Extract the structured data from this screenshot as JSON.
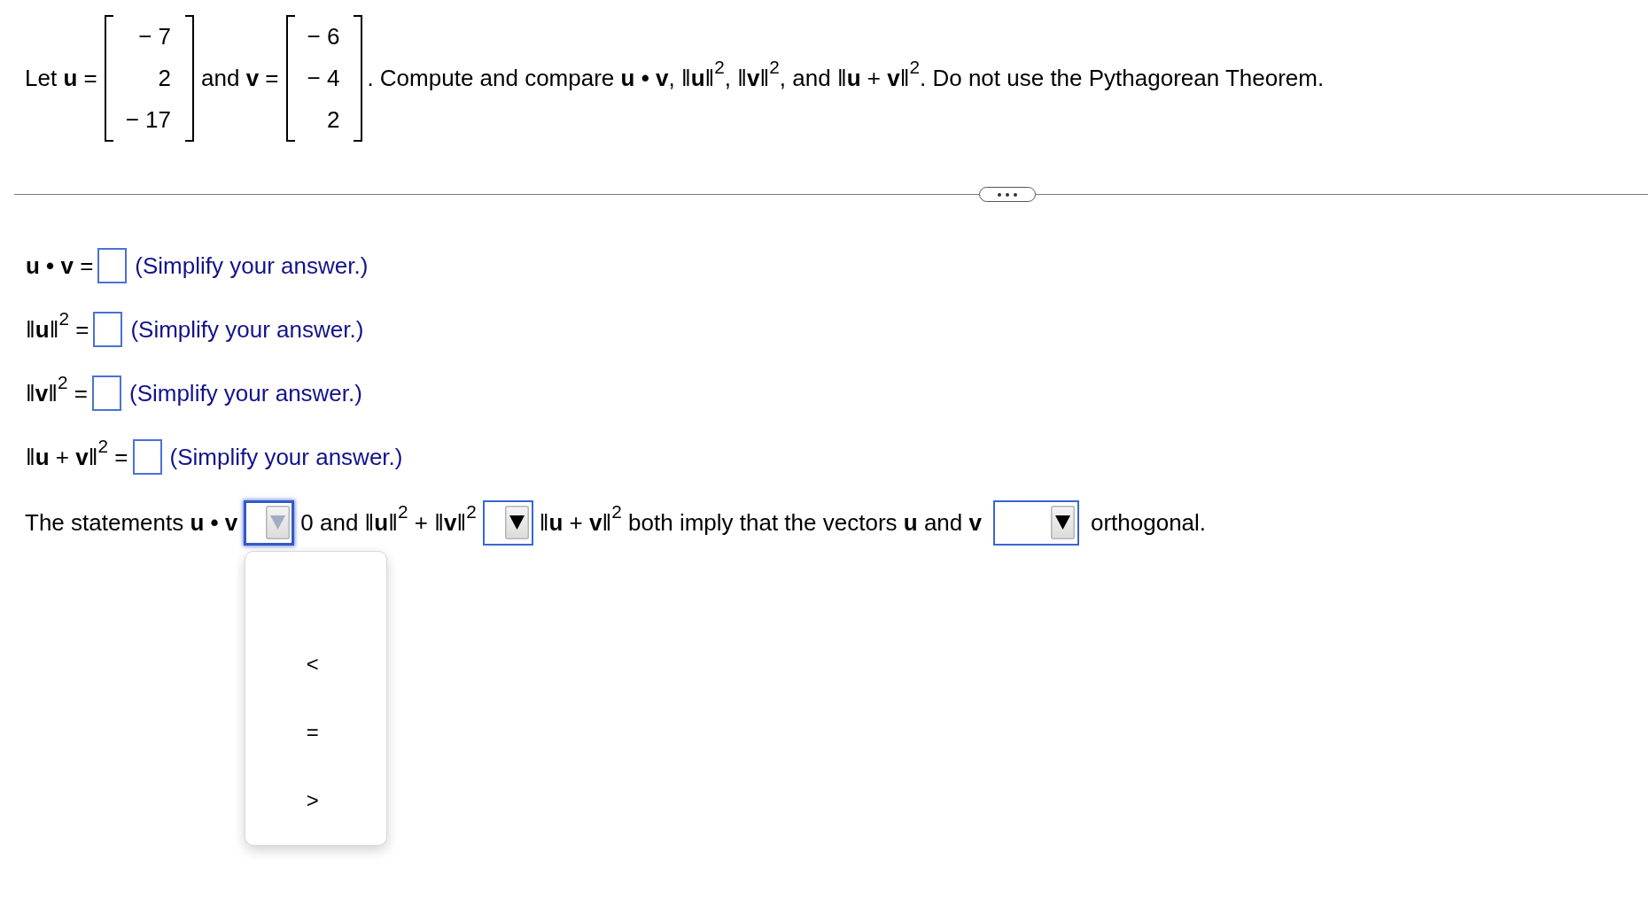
{
  "problem": {
    "intro": "Let **u** =",
    "vector_u": [
      "− 7",
      "2",
      "− 17"
    ],
    "connector": "and **v** =",
    "vector_v": [
      "− 6",
      "− 4",
      "2"
    ],
    "task": ". Compute and compare **u • v**, ‖**u**‖$^{2}$, ‖**v**‖$^{2}$, and ‖**u** + **v**‖$^{2}$. Do not use the Pythagorean Theorem."
  },
  "answers": [
    {
      "label": "**u • v** =",
      "hint": "(Simplify your answer.)"
    },
    {
      "label": "‖**u**‖$^{2}$ =",
      "hint": "(Simplify your answer.)"
    },
    {
      "label": "‖**v**‖$^{2}$ =",
      "hint": "(Simplify your answer.)"
    },
    {
      "label": "‖**u** + **v**‖$^{2}$ =",
      "hint": "(Simplify your answer.)"
    }
  ],
  "statement": [
    {
      "kind": "text",
      "text": "The statements **u • v**"
    },
    {
      "kind": "dropdown",
      "expanded": true
    },
    {
      "kind": "text",
      "text": "0 and ‖**u**‖$^{2}$ + ‖**v**‖$^{2}$"
    },
    {
      "kind": "dropdown",
      "expanded": false
    },
    {
      "kind": "text",
      "text": "‖**u** + **v**‖$^{2}$ both imply that the vectors **u** and **v**"
    },
    {
      "kind": "dropdown",
      "expanded": false
    },
    {
      "kind": "text",
      "text": "orthogonal."
    }
  ],
  "dropdown_menu": {
    "options": [
      {
        "label": "<",
        "selected": false
      },
      {
        "label": "=",
        "selected": false
      },
      {
        "label": ">",
        "selected": false
      }
    ]
  }
}
